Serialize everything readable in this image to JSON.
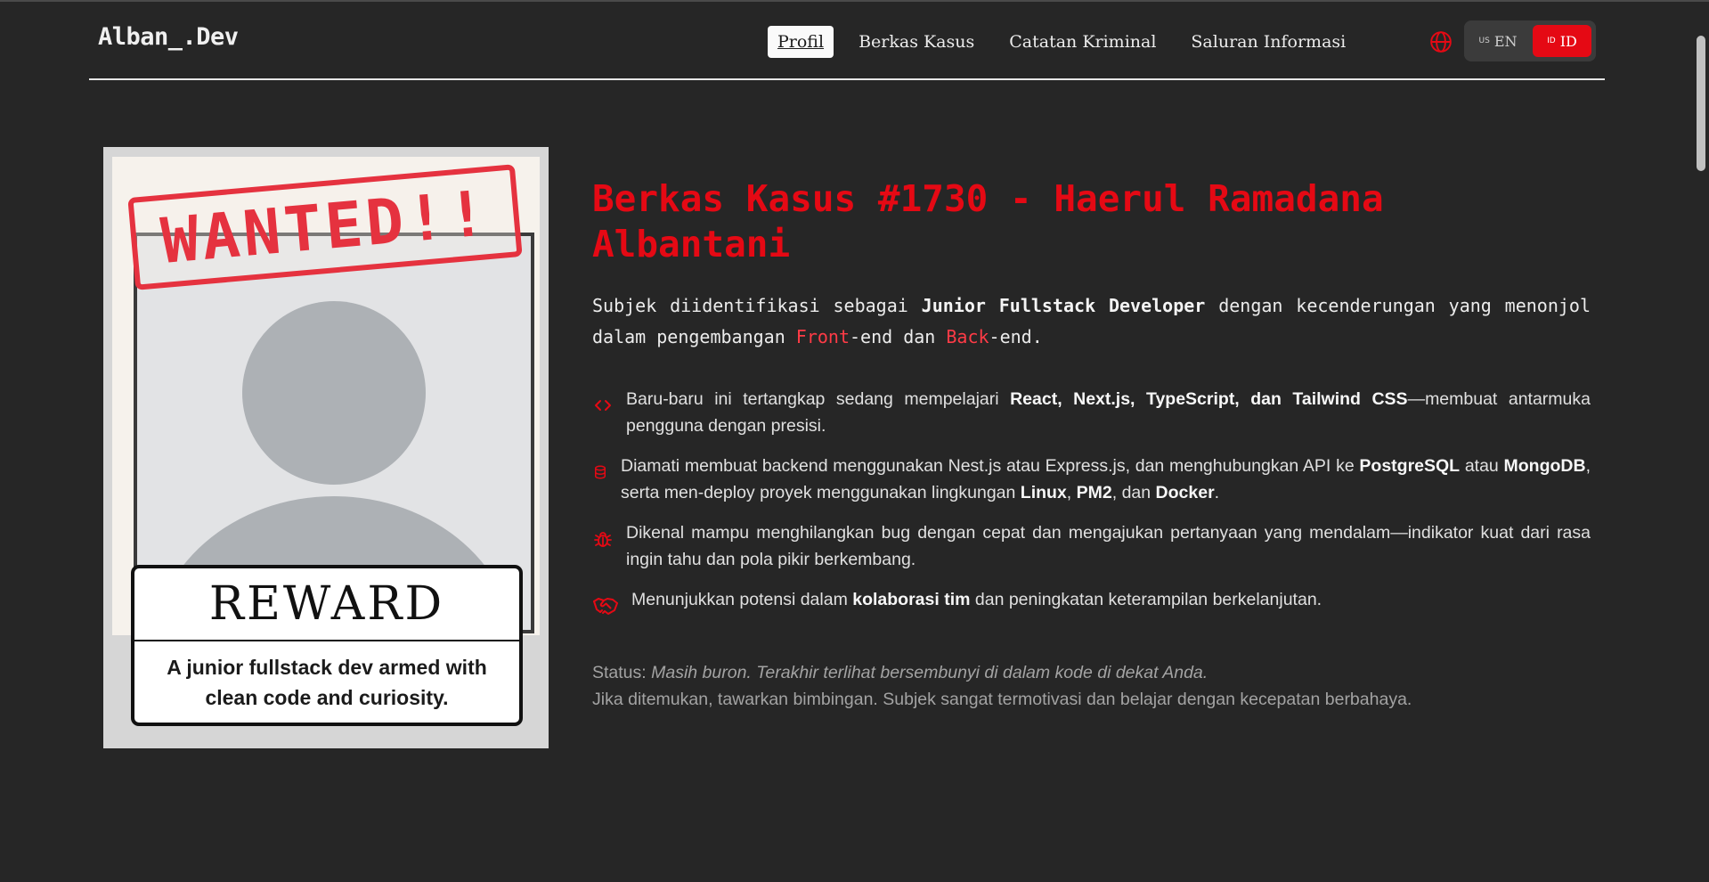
{
  "header": {
    "logo": "Alban_.Dev",
    "nav": [
      {
        "label": "Profil",
        "active": true
      },
      {
        "label": "Berkas Kasus"
      },
      {
        "label": "Catatan Kriminal"
      },
      {
        "label": "Saluran Informasi"
      }
    ],
    "lang": {
      "en_flag": "US",
      "en_label": "EN",
      "id_flag": "ID",
      "id_label": "ID",
      "selected": "ID"
    }
  },
  "poster": {
    "stamp": "WANTED!!",
    "reward_title": "REWARD",
    "reward_text": "A junior fullstack dev armed with clean code and curiosity."
  },
  "main": {
    "title": "Berkas Kasus #1730 - Haerul Ramadana Albantani",
    "intro": {
      "t1": "Subjek diidentifikasi sebagai ",
      "role": "Junior Fullstack Developer",
      "t2": " dengan kecenderungan yang menonjol dalam pengembangan ",
      "front": "Front",
      "t3": "-end dan ",
      "back": "Back",
      "t4": "-end."
    },
    "bullets": [
      {
        "icon": "code-icon",
        "a": "Baru-baru ini tertangkap sedang mempelajari ",
        "b1": "React, Next.js, TypeScript, dan Tailwind CSS",
        "c": "—membuat antarmuka pengguna dengan presisi."
      },
      {
        "icon": "database-icon",
        "a": "Diamati membuat backend menggunakan Nest.js atau Express.js, dan menghubungkan API ke ",
        "b1": "PostgreSQL",
        "c": " atau ",
        "b2": "MongoDB",
        "d": ", serta men-deploy proyek menggunakan lingkungan ",
        "b3": "Linux",
        "e": ", ",
        "b4": "PM2",
        "f": ", dan ",
        "b5": "Docker",
        "g": "."
      },
      {
        "icon": "bug-icon",
        "a": "Dikenal mampu menghilangkan bug dengan cepat dan mengajukan pertanyaan yang mendalam—indikator kuat dari rasa ingin tahu dan pola pikir berkembang."
      },
      {
        "icon": "handshake-icon",
        "a": "Menunjukkan potensi dalam ",
        "b1": "kolaborasi tim",
        "c": " dan peningkatan keterampilan berkelanjutan."
      }
    ],
    "status": {
      "label": "Status: ",
      "text": "Masih buron. Terakhir terlihat bersembunyi di dalam kode di dekat Anda.",
      "line2": "Jika ditemukan, tawarkan bimbingan. Subjek sangat termotivasi dan belajar dengan kecepatan berbahaya."
    }
  },
  "colors": {
    "accent": "#e50914",
    "background": "#262626"
  }
}
